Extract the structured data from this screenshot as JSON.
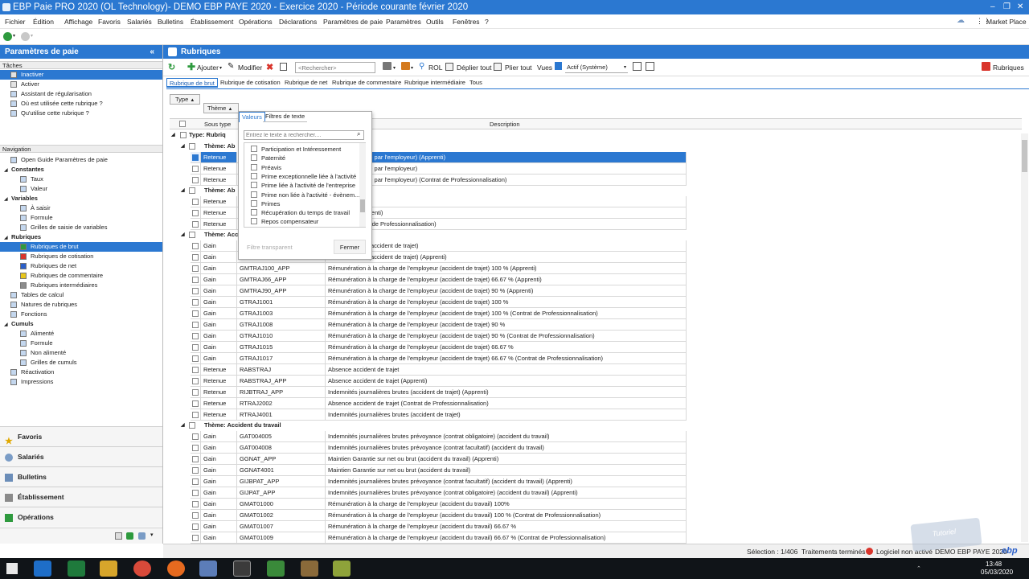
{
  "window": {
    "title": "EBP Paie PRO 2020 (OL Technology)- DEMO EBP PAYE 2020 - Exercice 2020 - Période courante février 2020"
  },
  "menu": [
    "Fichier",
    "Édition",
    "Affichage",
    "Favoris",
    "Salariés",
    "Bulletins",
    "Établissement",
    "Opérations",
    "Déclarations",
    "Paramètres de paie",
    "Paramètres",
    "Outils",
    "Fenêtres",
    "?"
  ],
  "market_place": "Market Place",
  "left_panel": {
    "title": "Paramètres de paie",
    "collapse_glyph": "«",
    "tasks_label": "Tâches",
    "tasks": [
      "Inactiver",
      "Activer",
      "Assistant de régularisation",
      "Où est utilisée cette rubrique ?",
      "Qu'utilise cette rubrique ?"
    ],
    "nav_label": "Navigation",
    "nav": [
      {
        "label": "Open Guide Paramètres de paie",
        "level": 1,
        "bold": false
      },
      {
        "label": "Constantes",
        "level": 0,
        "bold": true
      },
      {
        "label": "Taux",
        "level": 2,
        "bold": false
      },
      {
        "label": "Valeur",
        "level": 2,
        "bold": false
      },
      {
        "label": "Variables",
        "level": 0,
        "bold": true
      },
      {
        "label": "À saisir",
        "level": 2,
        "bold": false
      },
      {
        "label": "Formule",
        "level": 2,
        "bold": false
      },
      {
        "label": "Grilles de saisie de variables",
        "level": 2,
        "bold": false
      },
      {
        "label": "Rubriques",
        "level": 0,
        "bold": true
      },
      {
        "label": "Rubriques de brut",
        "level": 2,
        "bold": false,
        "selected": true,
        "color": "#2e9a3e"
      },
      {
        "label": "Rubriques de cotisation",
        "level": 2,
        "bold": false,
        "color": "#d9342b"
      },
      {
        "label": "Rubriques de net",
        "level": 2,
        "bold": false,
        "color": "#2b5fc9"
      },
      {
        "label": "Rubriques de commentaire",
        "level": 2,
        "bold": false,
        "color": "#e8c61a"
      },
      {
        "label": "Rubriques intermédiaires",
        "level": 2,
        "bold": false,
        "color": "#8c8c8c"
      },
      {
        "label": "Tables de calcul",
        "level": 1,
        "bold": false
      },
      {
        "label": "Natures de rubriques",
        "level": 1,
        "bold": false
      },
      {
        "label": "Fonctions",
        "level": 1,
        "bold": false
      },
      {
        "label": "Cumuls",
        "level": 0,
        "bold": true
      },
      {
        "label": "Alimenté",
        "level": 2,
        "bold": false
      },
      {
        "label": "Formule",
        "level": 2,
        "bold": false
      },
      {
        "label": "Non alimenté",
        "level": 2,
        "bold": false
      },
      {
        "label": "Grilles de cumuls",
        "level": 2,
        "bold": false
      },
      {
        "label": "Réactivation",
        "level": 1,
        "bold": false
      },
      {
        "label": "Impressions",
        "level": 1,
        "bold": false
      }
    ],
    "bottom_nav": [
      "Favoris",
      "Salariés",
      "Bulletins",
      "Établissement",
      "Opérations"
    ]
  },
  "main": {
    "title": "Rubriques",
    "toolbar": {
      "add": "Ajouter",
      "modify": "Modifier",
      "search_placeholder": "<Rechercher>",
      "rol": "ROL",
      "expand": "Déplier tout",
      "collapse": "Plier tout",
      "views": "Vues",
      "view_value": "Actif (Système)",
      "rubriques": "Rubriques"
    },
    "tabs": [
      "Rubrique de brut",
      "Rubrique de cotisation",
      "Rubrique de net",
      "Rubrique de commentaire",
      "Rubrique intermédiaire",
      "Tous"
    ],
    "group_by": {
      "type": "Type",
      "theme": "Thème"
    },
    "columns": {
      "sous_type": "Sous type",
      "description": "Description"
    },
    "type_group": "Type: Rubriq",
    "groups": [
      {
        "label": "Thème: Ab",
        "rows": [
          {
            "st": "Retenue",
            "code": "",
            "desc": "e (Non autorisée par l'employeur) (Apprenti)",
            "selected": true
          },
          {
            "st": "Retenue",
            "code": "",
            "desc": "e (Non autorisée par l'employeur)"
          },
          {
            "st": "Retenue",
            "code": "",
            "desc": "e (Non autorisée par l'employeur) (Contrat de Professionnalisation)"
          }
        ]
      },
      {
        "label": "Thème: Ab",
        "rows": [
          {
            "st": "Retenue",
            "code": "",
            "desc": "munérées"
          },
          {
            "st": "Retenue",
            "code": "",
            "desc": "munérées (Apprenti)"
          },
          {
            "st": "Retenue",
            "code": "",
            "desc": "unérée (Contrat de Professionnalisation)"
          }
        ]
      },
      {
        "label": "Thème: Acc",
        "rows": [
          {
            "st": "Gain",
            "code": "",
            "desc": "sur net ou brut (accident de trajet)"
          },
          {
            "st": "Gain",
            "code": "",
            "desc": "sur net ou brut (accident de trajet) (Apprenti)"
          },
          {
            "st": "Gain",
            "code": "GMTRAJ100_APP",
            "desc": "Rémunération à la charge de l'employeur (accident de trajet) 100 % (Apprenti)"
          },
          {
            "st": "Gain",
            "code": "GMTRAJ66_APP",
            "desc": "Rémunération à la charge de l'employeur (accident de trajet) 66.67 % (Apprenti)"
          },
          {
            "st": "Gain",
            "code": "GMTRAJ90_APP",
            "desc": "Rémunération à la charge de l'employeur (accident de trajet) 90 % (Apprenti)"
          },
          {
            "st": "Gain",
            "code": "GTRAJ1001",
            "desc": "Rémunération à la charge de l'employeur (accident de trajet) 100 %"
          },
          {
            "st": "Gain",
            "code": "GTRAJ1003",
            "desc": "Rémunération à la charge de l'employeur (accident de trajet) 100 % (Contrat de Professionnalisation)"
          },
          {
            "st": "Gain",
            "code": "GTRAJ1008",
            "desc": "Rémunération à la charge de l'employeur (accident de trajet) 90 %"
          },
          {
            "st": "Gain",
            "code": "GTRAJ1010",
            "desc": "Rémunération à la charge de l'employeur (accident de trajet) 90 % (Contrat de Professionnalisation)"
          },
          {
            "st": "Gain",
            "code": "GTRAJ1015",
            "desc": "Rémunération à la charge de l'employeur (accident de trajet) 66.67 %"
          },
          {
            "st": "Gain",
            "code": "GTRAJ1017",
            "desc": "Rémunération à la charge de l'employeur (accident de trajet) 66.67 % (Contrat de Professionnalisation)"
          },
          {
            "st": "Retenue",
            "code": "RABSTRAJ",
            "desc": "Absence accident de trajet"
          },
          {
            "st": "Retenue",
            "code": "RABSTRAJ_APP",
            "desc": "Absence accident de trajet (Apprenti)"
          },
          {
            "st": "Retenue",
            "code": "RIJBTRAJ_APP",
            "desc": "Indemnités journalières brutes  (accident de trajet) (Apprenti)"
          },
          {
            "st": "Retenue",
            "code": "RTRAJ2002",
            "desc": "Absence accident de trajet (Contrat de Professionnalisation)"
          },
          {
            "st": "Retenue",
            "code": "RTRAJ4001",
            "desc": "Indemnités journalières brutes  (accident de trajet)"
          }
        ]
      },
      {
        "label": "Thème: Accident du travail",
        "rows": [
          {
            "st": "Gain",
            "code": "GAT004005",
            "desc": "Indemnités journalières brutes prévoyance (contrat obligatoire) (accident du travail)"
          },
          {
            "st": "Gain",
            "code": "GAT004008",
            "desc": "Indemnités journalières brutes prévoyance (contrat facultatif) (accident du travail)"
          },
          {
            "st": "Gain",
            "code": "GGNAT_APP",
            "desc": "Maintien Garantie sur net ou brut (accident du travail) (Apprenti)"
          },
          {
            "st": "Gain",
            "code": "GGNAT4001",
            "desc": "Maintien Garantie sur net ou brut (accident du travail)"
          },
          {
            "st": "Gain",
            "code": "GIJBPAT_APP",
            "desc": "Indemnités journalières brutes prévoyance (contrat facultatif) (accident du travail) (Apprenti)"
          },
          {
            "st": "Gain",
            "code": "GIJPAT_APP",
            "desc": "Indemnités journalières brutes prévoyance (contrat obligatoire) (accident du travail) (Apprenti)"
          },
          {
            "st": "Gain",
            "code": "GMAT01000",
            "desc": "Rémunération à la charge de l'employeur (accident du travail) 100%"
          },
          {
            "st": "Gain",
            "code": "GMAT01002",
            "desc": "Rémunération à la charge de l'employeur (accident du travail) 100 % (Contrat de Professionnalisation)"
          },
          {
            "st": "Gain",
            "code": "GMAT01007",
            "desc": "Rémunération à la charge de l'employeur (accident du travail) 66.67 %"
          },
          {
            "st": "Gain",
            "code": "GMAT01009",
            "desc": "Rémunération à la charge de l'employeur (accident du travail) 66.67 % (Contrat de Professionnalisation)"
          }
        ]
      }
    ]
  },
  "filter_popup": {
    "tab_values": "Valeurs",
    "tab_text_filters": "Filtres de texte",
    "search_placeholder": "Entrez le texte à rechercher....",
    "items": [
      "Participation et Intéressement",
      "Paternité",
      "Préavis",
      "Prime exceptionnelle liée à l'activité",
      "Prime liée à l'activité de l'entreprise",
      "Prime non liée à l'activité - évènem...",
      "Primes",
      "Récupération du temps de travail",
      "Repos compensateur"
    ],
    "transparent_filter": "Filtre transparent",
    "close": "Fermer"
  },
  "status": {
    "selection": "Sélection : 1/406",
    "processing": "Traitements terminés",
    "license": "Logiciel non activé",
    "company": "DEMO EBP PAYE 2020",
    "brand": "ebp"
  },
  "watermark": "Tutoriel",
  "clock": {
    "time": "13:48",
    "date": "05/03/2020"
  },
  "colors": {
    "accent": "#2b78d1",
    "selected": "#2b78d1",
    "green": "#2e9a3e",
    "red": "#d9342b"
  }
}
